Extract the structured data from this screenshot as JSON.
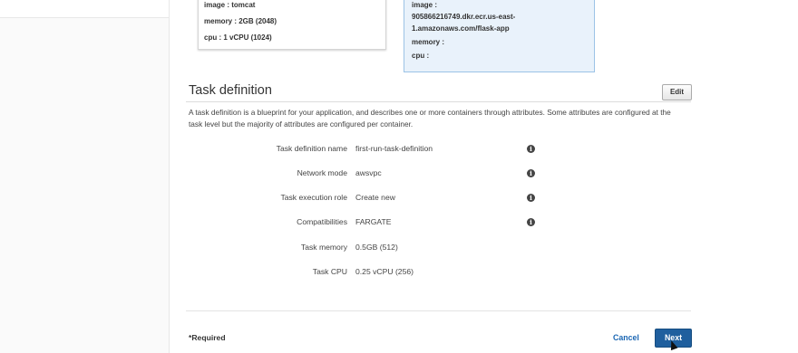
{
  "container_card_1": {
    "image": "image : tomcat",
    "memory": "memory :  2GB (2048)",
    "cpu": "cpu :  1 vCPU (1024)"
  },
  "container_card_2": {
    "image_label": "image :",
    "image_line1": "905866216749.dkr.ecr.us-east-",
    "image_line2": "1.amazonaws.com/flask-app",
    "memory": "memory :",
    "cpu": "cpu :"
  },
  "task_definition": {
    "title": "Task definition",
    "edit_label": "Edit",
    "description": "A task definition is a blueprint for your application, and describes one or more containers through attributes. Some attributes are configured at the task level but the majority of attributes are configured per container.",
    "fields": [
      {
        "label": "Task definition name",
        "value": "first-run-task-definition",
        "info": true
      },
      {
        "label": "Network mode",
        "value": "awsvpc",
        "info": true
      },
      {
        "label": "Task execution role",
        "value": "Create new",
        "info": true
      },
      {
        "label": "Compatibilities",
        "value": "FARGATE",
        "info": true
      },
      {
        "label": "Task memory",
        "value": "0.5GB (512)",
        "info": false
      },
      {
        "label": "Task CPU",
        "value": "0.25 vCPU (256)",
        "info": false
      }
    ]
  },
  "footer": {
    "required": "*Required",
    "cancel": "Cancel",
    "next": "Next"
  },
  "colors": {
    "primary_button": "#1f5f9e",
    "link": "#1a66b3",
    "highlight_card": "#e9f2fb"
  },
  "icons": {
    "info": "info-circle-icon"
  }
}
